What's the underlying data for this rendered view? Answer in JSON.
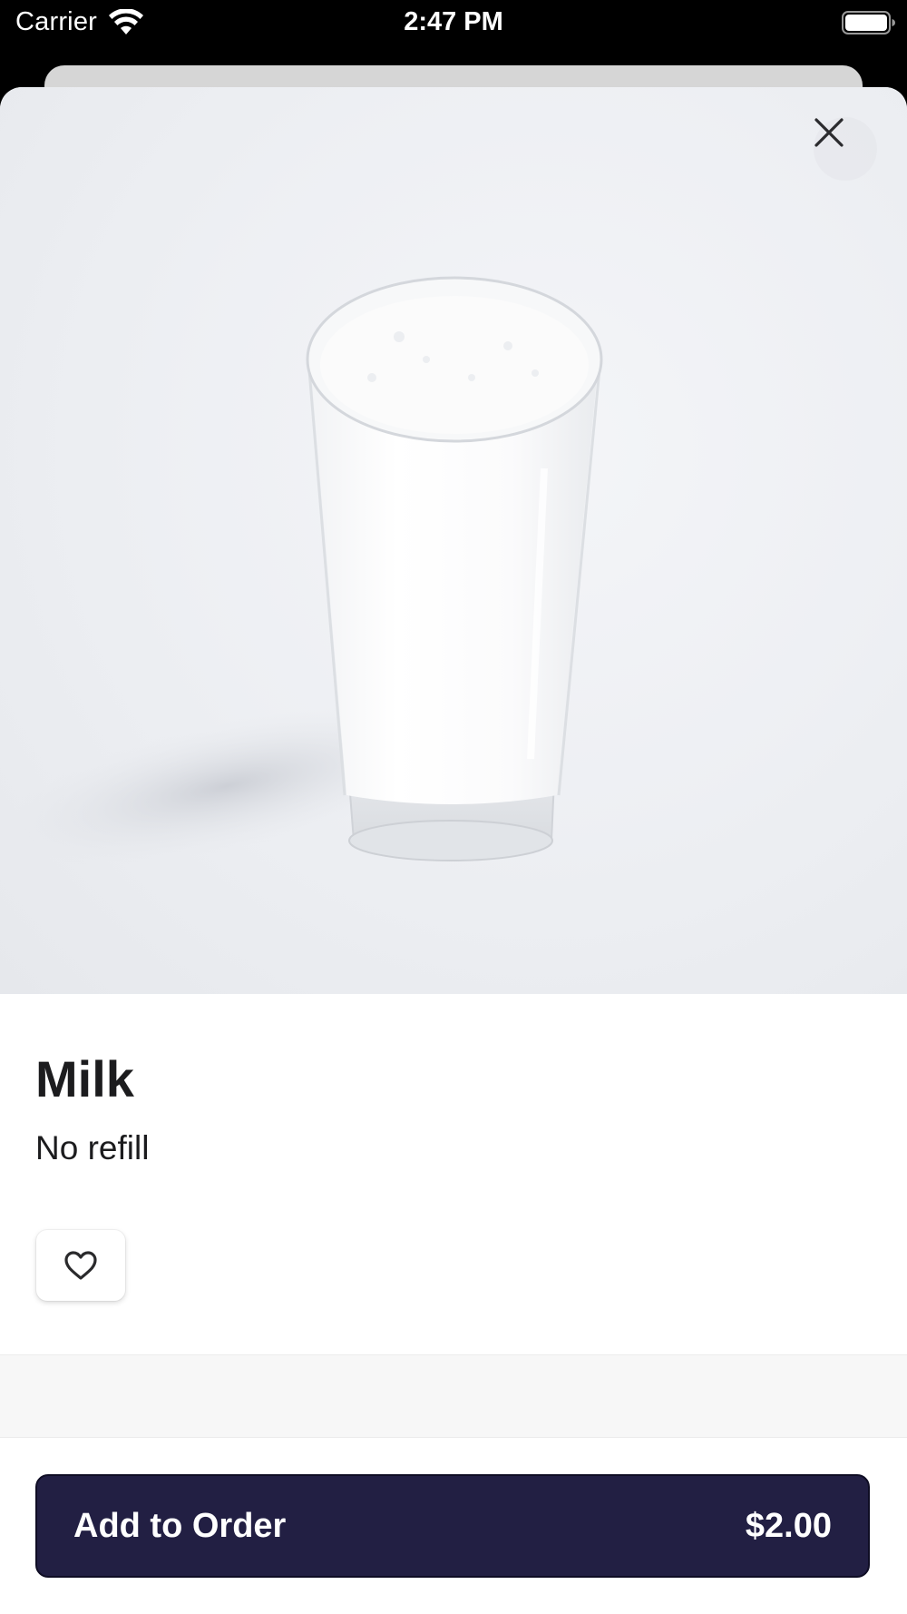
{
  "status_bar": {
    "carrier": "Carrier",
    "time": "2:47 PM",
    "wifi_icon": "wifi-icon",
    "battery_icon": "battery-icon"
  },
  "product": {
    "name": "Milk",
    "description": "No refill",
    "image_subject": "glass of milk"
  },
  "actions": {
    "close_icon": "close-icon",
    "favorite_icon": "heart-outline-icon",
    "add_label": "Add to Order",
    "price": "$2.00"
  },
  "colors": {
    "primary_button": "#221f43",
    "text": "#1c1c1e",
    "background": "#ffffff"
  }
}
